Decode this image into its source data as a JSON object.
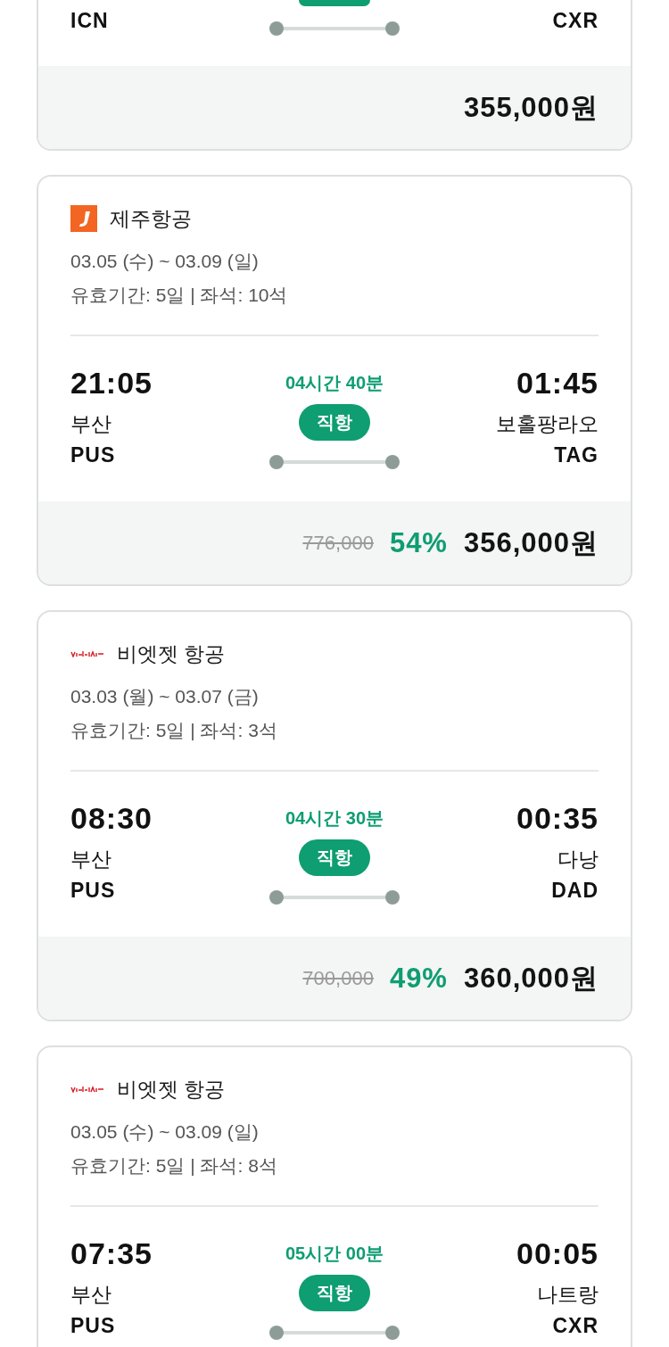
{
  "flights": [
    {
      "kind": "tail",
      "departure": {
        "code": "ICN"
      },
      "arrival": {
        "code": "CXR"
      },
      "price": "355,000원"
    },
    {
      "kind": "full",
      "airline": {
        "name": "제주항공",
        "kind": "jeju"
      },
      "dates": "03.05 (수) ~ 03.09 (일)",
      "validity": "유효기간: 5일 | 좌석: 10석",
      "departure": {
        "time": "21:05",
        "city": "부산",
        "code": "PUS"
      },
      "duration": "04시간 40분",
      "route_type": "직항",
      "arrival": {
        "time": "01:45",
        "city": "보홀팡라오",
        "code": "TAG"
      },
      "original_price": "776,000",
      "discount": "54%",
      "price": "356,000원"
    },
    {
      "kind": "full",
      "airline": {
        "name": "비엣젯 항공",
        "kind": "vietjet"
      },
      "dates": "03.03 (월) ~ 03.07 (금)",
      "validity": "유효기간: 5일 | 좌석: 3석",
      "departure": {
        "time": "08:30",
        "city": "부산",
        "code": "PUS"
      },
      "duration": "04시간 30분",
      "route_type": "직항",
      "arrival": {
        "time": "00:35",
        "city": "다낭",
        "code": "DAD"
      },
      "original_price": "700,000",
      "discount": "49%",
      "price": "360,000원"
    },
    {
      "kind": "head",
      "airline": {
        "name": "비엣젯 항공",
        "kind": "vietjet"
      },
      "dates": "03.05 (수) ~ 03.09 (일)",
      "validity": "유효기간: 5일 | 좌석: 8석",
      "departure": {
        "time": "07:35",
        "city": "부산",
        "code": "PUS"
      },
      "duration": "05시간 00분",
      "route_type": "직항",
      "arrival": {
        "time": "00:05",
        "city": "나트랑",
        "code": "CXR"
      }
    }
  ]
}
